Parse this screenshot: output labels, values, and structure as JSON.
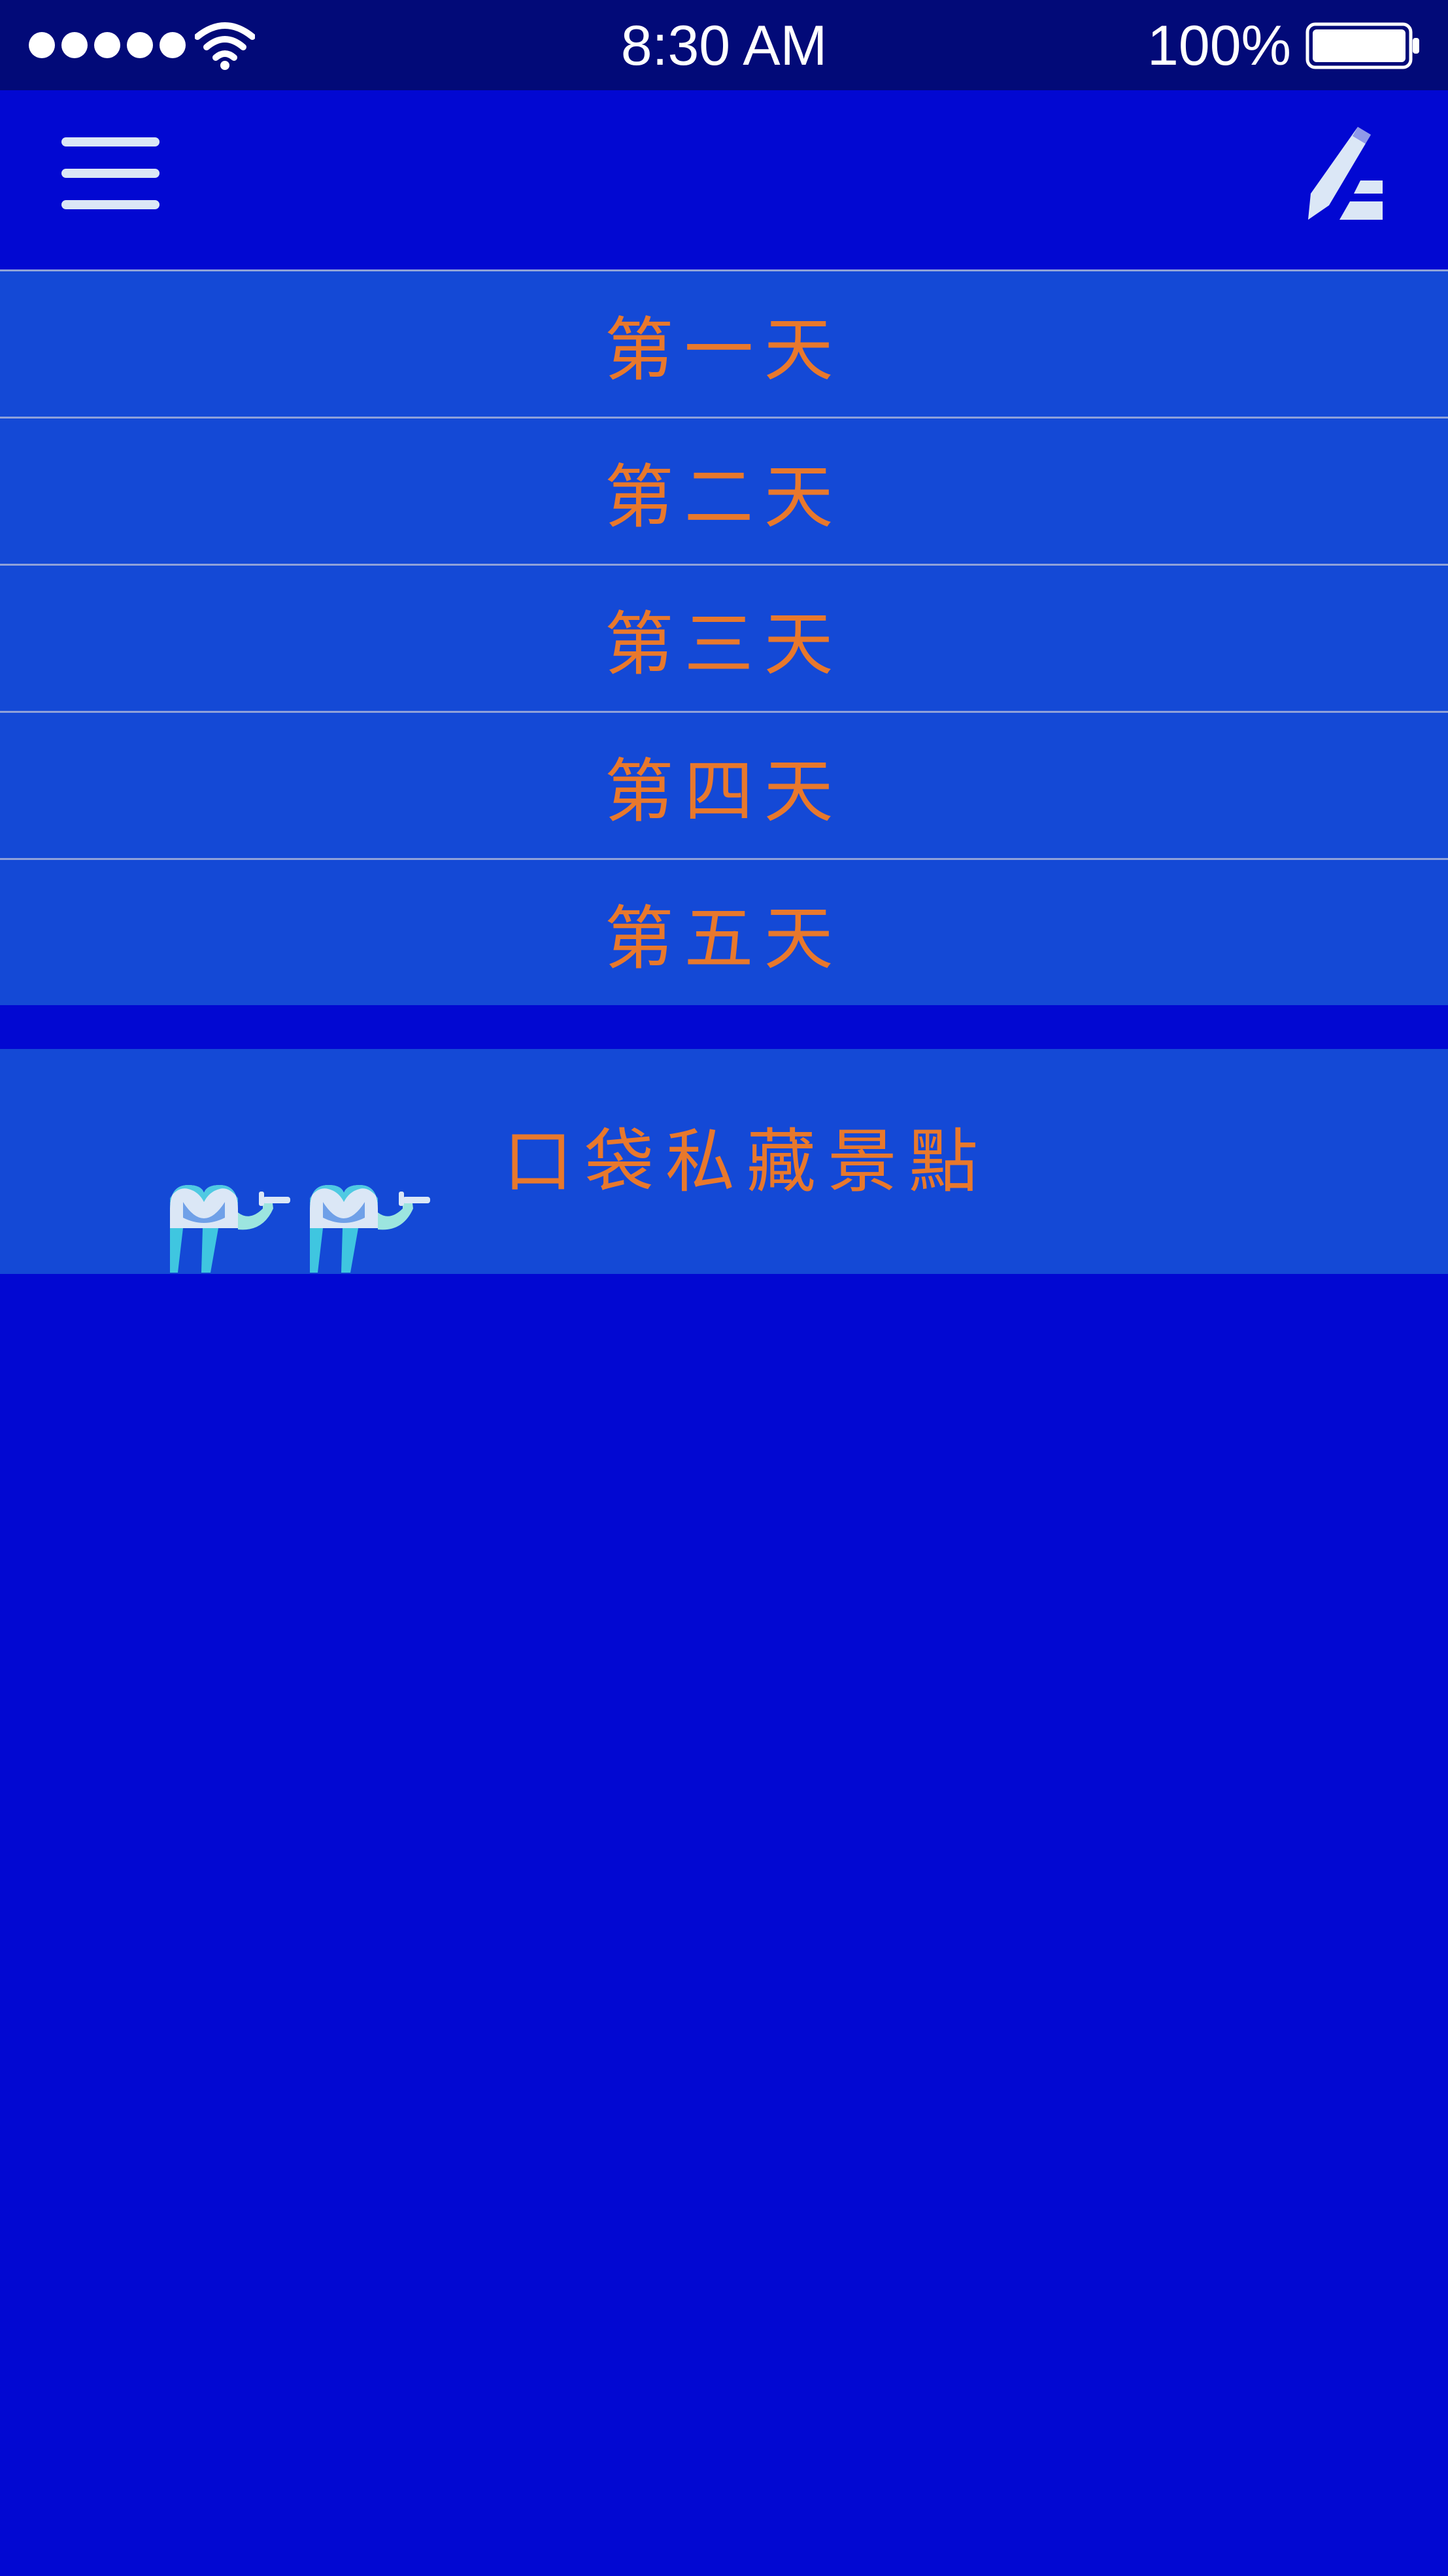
{
  "status_bar": {
    "time": "8:30 AM",
    "battery_percent": "100%",
    "signal_bars": 5,
    "battery_level": 1.0,
    "icons": [
      "signal-dots-icon",
      "wifi-icon",
      "battery-icon"
    ]
  },
  "nav_bar": {
    "left_icon": "menu-icon",
    "right_icon": "edit-icon"
  },
  "days": [
    {
      "label": "第一天"
    },
    {
      "label": "第二天"
    },
    {
      "label": "第三天"
    },
    {
      "label": "第四天"
    },
    {
      "label": "第五天"
    }
  ],
  "spots": {
    "label": "口袋私藏景點",
    "icon": "camel-icon"
  },
  "colors": {
    "background": "#0208d2",
    "status_bar": "#020a78",
    "row": "#1449d6",
    "row_divider": "#8fa1d9",
    "label_text": "#e8782c",
    "icon_light": "#dbe7f6"
  }
}
